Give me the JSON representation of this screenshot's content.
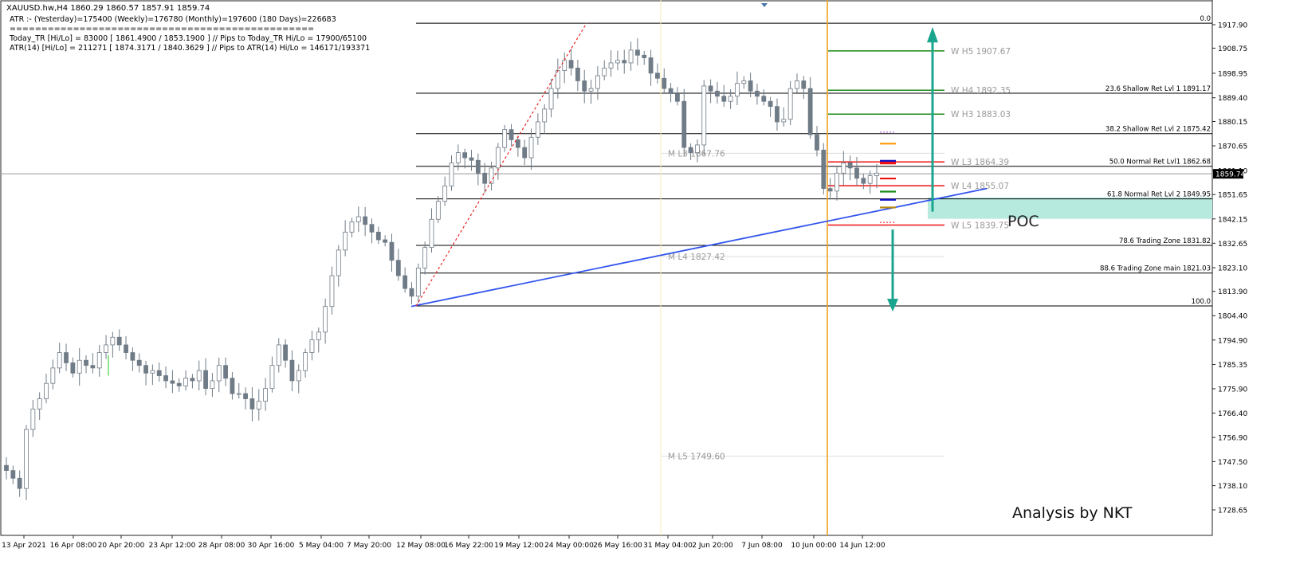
{
  "header": {
    "symbol_line": "XAUUSD.hw,H4  1860.29 1860.57 1857.91 1859.74",
    "atr_line": "ATR :- (Yesterday)=175400       (Weekly)=176780      (Monthly)=197600      (180 Days)=226683",
    "separator": "================================================",
    "today_tr_line": "Today_TR [Hi/Lo] = 83000 [ 1861.4900 / 1853.1900 ]   // Pips to Today_TR Hi/Lo  = 17900/65100",
    "atr14_line": "ATR(14)       [Hi/Lo] = 211271 [ 1874.3171 / 1840.3629 ]  //  Pips to ATR(14) Hi/Lo       = 146171/193371"
  },
  "watermark": "Analysis by NKT",
  "poc_label": "POC",
  "colors": {
    "candle": "#6f7b86",
    "fib_line": "#000000",
    "trendline": "#3355ee",
    "vline": "#f0a020",
    "green": "#1a8a1a",
    "red": "#ee1111",
    "arrow": "#1aa58f",
    "poc_fill": "#b6eadf"
  },
  "chart_data": {
    "type": "candlestick",
    "symbol": "XAUUSD",
    "timeframe": "H4",
    "last_price": "1859.74",
    "ylim": [
      1724,
      1922
    ],
    "price_ticks": [
      "1917.90",
      "1908.75",
      "1898.95",
      "1889.40",
      "1880.15",
      "1870.65",
      "1861.10",
      "1851.65",
      "1842.15",
      "1832.65",
      "1823.10",
      "1813.90",
      "1804.40",
      "1794.90",
      "1785.35",
      "1775.90",
      "1766.40",
      "1756.90",
      "1747.50",
      "1738.10",
      "1728.65"
    ],
    "time_ticks": [
      "13 Apr 2021",
      "16 Apr 08:00",
      "20 Apr 20:00",
      "23 Apr 12:00",
      "28 Apr 08:00",
      "30 Apr 16:00",
      "5 May 04:00",
      "7 May 20:00",
      "12 May 08:00",
      "16 May 22:00",
      "19 May 12:00",
      "24 May 00:00",
      "26 May 16:00",
      "31 May 04:00",
      "2 Jun 20:00",
      "7 Jun 08:00",
      "10 Jun 00:00",
      "14 Jun 12:00"
    ],
    "close_path": [
      1744,
      1741,
      1737,
      1760,
      1768,
      1772,
      1778,
      1784,
      1790,
      1786,
      1782,
      1787,
      1785,
      1784,
      1790,
      1793,
      1796,
      1793,
      1790,
      1787,
      1785,
      1782,
      1783,
      1781,
      1779,
      1778,
      1777,
      1780,
      1779,
      1783,
      1776,
      1779,
      1785,
      1780,
      1774,
      1774,
      1772,
      1768,
      1771,
      1776,
      1785,
      1793,
      1787,
      1779,
      1783,
      1790,
      1795,
      1798,
      1808,
      1820,
      1830,
      1837,
      1841,
      1843,
      1840,
      1837,
      1834,
      1833,
      1826,
      1820,
      1815,
      1812,
      1823,
      1831,
      1842,
      1849,
      1855,
      1864,
      1868,
      1866,
      1865,
      1860,
      1856,
      1862,
      1870,
      1877,
      1873,
      1870,
      1866,
      1874,
      1880,
      1885,
      1893,
      1900,
      1904,
      1901,
      1896,
      1892,
      1893,
      1898,
      1901,
      1903,
      1904,
      1903,
      1908,
      1906,
      1905,
      1899,
      1897,
      1893,
      1891,
      1888,
      1870,
      1868,
      1871,
      1894,
      1892,
      1890,
      1888,
      1890,
      1895,
      1896,
      1892,
      1890,
      1888,
      1886,
      1880,
      1881,
      1893,
      1896,
      1893,
      1875,
      1869,
      1854,
      1853,
      1860,
      1864,
      1862,
      1858,
      1856,
      1859,
      1860
    ],
    "fib_levels": [
      {
        "label": "0.0",
        "price": 1918.5
      },
      {
        "label": "23.6 Shallow Ret Lvl 1 1891.17",
        "price": 1891.17
      },
      {
        "label": "38.2 Shallow Ret Lvl 2 1875.42",
        "price": 1875.42
      },
      {
        "label": "50.0 Normal Ret Lvl1 1862.68",
        "price": 1862.68
      },
      {
        "label": "61.8 Normal Ret Lvl 2 1849.95",
        "price": 1849.95
      },
      {
        "label": "78.6 Trading Zone 1831.82",
        "price": 1831.82
      },
      {
        "label": "88.6 Trading Zone main 1821.03",
        "price": 1821.03
      },
      {
        "label": "100.0",
        "price": 1808.2
      }
    ],
    "weekly_levels": [
      {
        "label": "W  H5 1907.67",
        "price": 1907.67,
        "color": "green"
      },
      {
        "label": "W  H4 1892.35",
        "price": 1892.35,
        "color": "green"
      },
      {
        "label": "W  H3 1883.03",
        "price": 1883.03,
        "color": "green"
      },
      {
        "label": "W  L3 1864.39",
        "price": 1864.39,
        "color": "red"
      },
      {
        "label": "W  L4 1855.07",
        "price": 1855.07,
        "color": "red"
      },
      {
        "label": "W  L5 1839.75",
        "price": 1839.75,
        "color": "red"
      }
    ],
    "monthly_levels": [
      {
        "label": "M  L3 1867.76",
        "price": 1867.76
      },
      {
        "label": "M  L4 1827.42",
        "price": 1827.42
      },
      {
        "label": "M  L5 1749.60",
        "price": 1749.6
      }
    ],
    "poc_zone": [
      1842.2,
      1850.5
    ]
  }
}
